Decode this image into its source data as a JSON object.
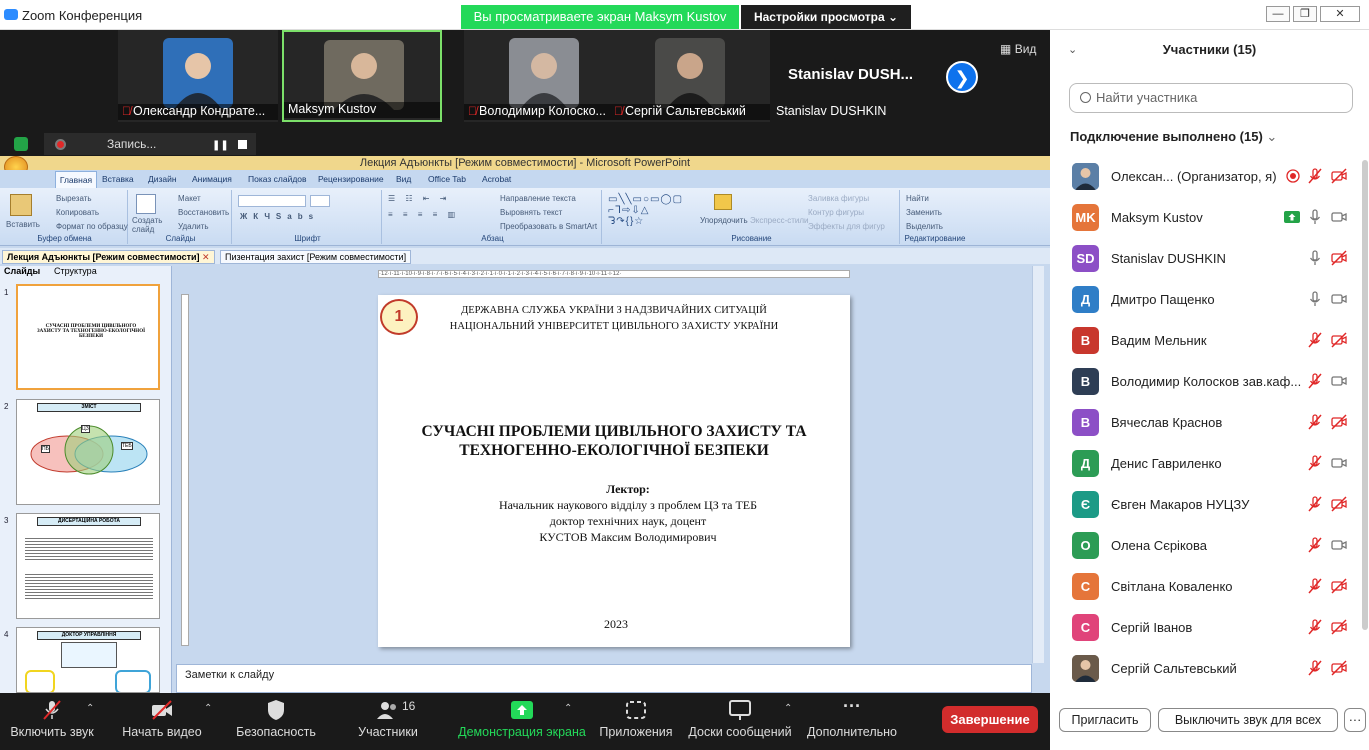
{
  "window": {
    "title": "Zoom Конференция",
    "share_banner": "Вы просматриваете экран Maksym Kustov",
    "view_options": "Настройки просмотра"
  },
  "video": {
    "tiles": [
      {
        "name": "Олександр Кондрате...",
        "muted": true
      },
      {
        "name": "Maksym Kustov",
        "muted": false
      },
      {
        "name": "Володимир Колоско...",
        "muted": true
      },
      {
        "name": "Сергій Сальтевський",
        "muted": true
      },
      {
        "name": "Stanislav DUSHKIN",
        "big_name": "Stanislav  DUSH...",
        "muted": false
      }
    ],
    "view_label": "Вид"
  },
  "recording": {
    "label": "Запись..."
  },
  "ppt": {
    "title": "Лекция Адъюнкты [Режим совместимости] - Microsoft PowerPoint",
    "tabs": [
      "Главная",
      "Вставка",
      "Дизайн",
      "Анимация",
      "Показ слайдов",
      "Рецензирование",
      "Вид",
      "Office Tab",
      "Acrobat"
    ],
    "groups": {
      "clipboard": "Буфер обмена",
      "slides": "Слайды",
      "font": "Шрифт",
      "paragraph": "Абзац",
      "drawing": "Рисование",
      "editing": "Редактирование"
    },
    "ribbon_items": {
      "paste": "Вставить",
      "cut": "Вырезать",
      "copy": "Копировать",
      "format_painter": "Формат по образцу",
      "new_slide": "Создать слайд",
      "layout": "Макет",
      "reset": "Восстановить",
      "delete": "Удалить",
      "text_direction": "Направление текста",
      "align_text": "Выровнять текст",
      "smartart": "Преобразовать в SmartArt",
      "arrange": "Упорядочить",
      "quick_styles": "Экспресс-стили",
      "shape_fill": "Заливка фигуры",
      "shape_outline": "Контур фигуры",
      "shape_effects": "Эффекты для фигур",
      "find": "Найти",
      "replace": "Заменить",
      "select": "Выделить"
    },
    "doc_tabs": [
      "Лекция Адъюнкты [Режим совместимости]",
      "Пизентация захист [Режим совместимости]"
    ],
    "pane_tabs": [
      "Слайды",
      "Структура"
    ],
    "ruler": "·12·ı·11·ı·10·ı·9·ı·8·ı·7·ı·6·ı·5·ı·4·ı·3·ı·2·ı·1·ı·0·ı·1·ı·2·ı·3·ı·4·ı·5·ı·6·ı·7·ı·8·ı·9·ı·10·ı·11·ı·12·",
    "thumbnails": [
      {
        "num": "1",
        "title": "СУЧАСНІ ПРОБЛЕМИ ЦИВІЛЬНОГО ЗАХИСТУ ТА ТЕХНОГЕННО-ЕКОЛОГІЧНОЇ БЕЗПЕКИ"
      },
      {
        "num": "2",
        "title": "ЗМІСТ",
        "labels": [
          "ЦЗ",
          "ПБ",
          "ТЕБ"
        ]
      },
      {
        "num": "3",
        "title": "ДИСЕРТАЦІЙНА РОБОТА"
      },
      {
        "num": "4",
        "title": "ДОКТОР УПРАВЛІННЯ"
      }
    ],
    "slide": {
      "number": "1",
      "org1": "ДЕРЖАВНА СЛУЖБА УКРАЇНИ З НАДЗВИЧАЙНИХ СИТУАЦІЙ",
      "org2": "НАЦІОНАЛЬНИЙ УНІВЕРСИТЕТ ЦИВІЛЬНОГО ЗАХИСТУ УКРАЇНИ",
      "title1": "СУЧАСНІ ПРОБЛЕМИ ЦИВІЛЬНОГО ЗАХИСТУ ТА",
      "title2": "ТЕХНОГЕННО-ЕКОЛОГІЧНОЇ БЕЗПЕКИ",
      "lector_label": "Лектор:",
      "line1": "Начальник наукового відділу з проблем ЦЗ та ТЕБ",
      "line2": "доктор технічних наук, доцент",
      "line3": "КУСТОВ Максим Володимирович",
      "year": "2023"
    },
    "notes_placeholder": "Заметки к слайду"
  },
  "sidebar": {
    "title": "Участники (15)",
    "search_placeholder": "Найти участника",
    "connected_label": "Подключение выполнено (15)",
    "participants": [
      {
        "initials": "",
        "name": "Олексан...  (Организатор, я)",
        "color": "#5b7fa6",
        "photo": true,
        "mic": "off",
        "cam": "off",
        "rec": true
      },
      {
        "initials": "MK",
        "name": "Maksym Kustov",
        "color": "#e5753a",
        "mic": "on",
        "cam": "on",
        "share": true
      },
      {
        "initials": "SD",
        "name": "Stanislav DUSHKIN",
        "color": "#8c4fc6",
        "mic": "on",
        "cam": "off"
      },
      {
        "initials": "Д",
        "name": "Дмитро Пащенко",
        "color": "#2f7ec7",
        "mic": "on",
        "cam": "on"
      },
      {
        "initials": "В",
        "name": "Вадим Мельник",
        "color": "#c8372d",
        "mic": "off",
        "cam": "off"
      },
      {
        "initials": "В",
        "name": "Володимир  Колосков зав.каф...",
        "color": "#2e3e55",
        "mic": "off",
        "cam": "on"
      },
      {
        "initials": "В",
        "name": "Вячеслав Краснов",
        "color": "#8c4fc6",
        "mic": "off",
        "cam": "off"
      },
      {
        "initials": "Д",
        "name": "Денис Гавриленко",
        "color": "#2c9c55",
        "mic": "off",
        "cam": "on"
      },
      {
        "initials": "Є",
        "name": "Євген Макаров НУЦЗУ",
        "color": "#1c9a86",
        "mic": "off",
        "cam": "off"
      },
      {
        "initials": "О",
        "name": "Олена Сєрікова",
        "color": "#2c9c55",
        "mic": "off",
        "cam": "on"
      },
      {
        "initials": "С",
        "name": "Світлана Коваленко",
        "color": "#e5753a",
        "mic": "off",
        "cam": "off"
      },
      {
        "initials": "С",
        "name": "Сергій Іванов",
        "color": "#e0447a",
        "mic": "off",
        "cam": "off"
      },
      {
        "initials": "",
        "name": "Сергій Сальтевський",
        "color": "#6a5a4a",
        "photo": true,
        "mic": "off",
        "cam": "off"
      }
    ],
    "invite": "Пригласить",
    "mute_all": "Выключить звук для всех",
    "more": "···"
  },
  "toolbar": {
    "unmute": "Включить звук",
    "start_video": "Начать видео",
    "security": "Безопасность",
    "participants": "Участники",
    "participants_count": "16",
    "share": "Демонстрация экрана",
    "apps": "Приложения",
    "whiteboards": "Доски сообщений",
    "more": "Дополнительно",
    "end": "Завершение"
  },
  "colors": {
    "zoom_blue": "#0e72ed",
    "share_green": "#23d959",
    "end_red": "#d22c2c",
    "muted_red": "#e02828"
  }
}
